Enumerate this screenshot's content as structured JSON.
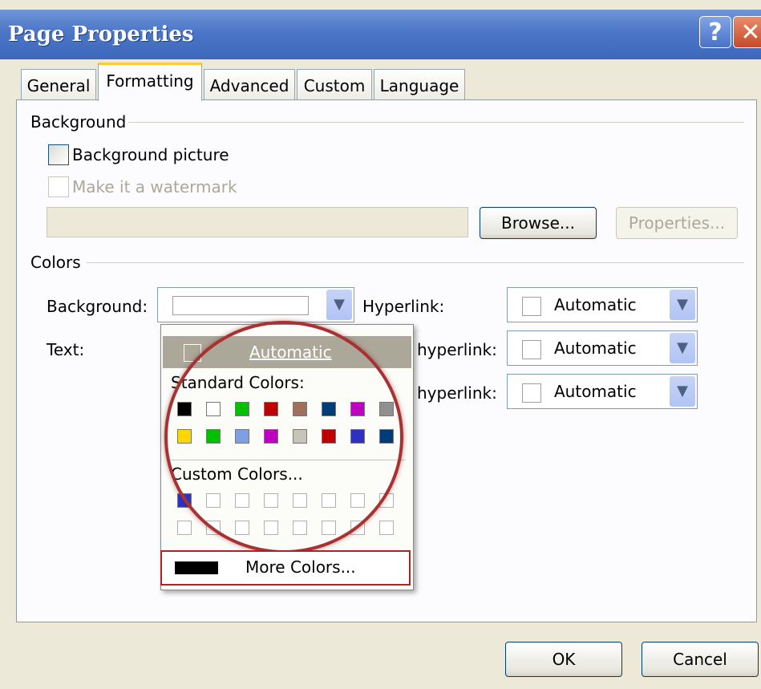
{
  "window": {
    "title": "Page Properties",
    "help_glyph": "?",
    "close_glyph": "✕"
  },
  "tabs": [
    {
      "label": "General"
    },
    {
      "label": "Formatting",
      "active": true
    },
    {
      "label": "Advanced"
    },
    {
      "label": "Custom"
    },
    {
      "label": "Language"
    }
  ],
  "background_group": {
    "label": "Background",
    "background_picture_label": "Background picture",
    "watermark_label": "Make it a watermark",
    "picture_path_value": "",
    "browse_label": "Browse...",
    "properties_label": "Properties..."
  },
  "colors_group": {
    "label": "Colors",
    "background_label": "Background:",
    "text_label": "Text:",
    "hyperlink_label": "Hyperlink:",
    "visited_label": "hyperlink:",
    "active_label": "hyperlink:",
    "automatic": "Automatic",
    "arrow_glyph": "▼"
  },
  "color_picker": {
    "automatic_label": "Automatic",
    "standard_label": "Standard Colors:",
    "custom_label": "Custom Colors...",
    "more_label": "More Colors...",
    "standard_colors": [
      "#000000",
      "#ffffff",
      "#00c000",
      "#c00000",
      "#a0705a",
      "#003c78",
      "#c000c0",
      "#909090",
      "#ffd700",
      "#00c000",
      "#7fa0e0",
      "#c000c0",
      "#c8c4b8",
      "#c00000",
      "#3030c0",
      "#003c78"
    ],
    "custom_colors": [
      "#2b34c8",
      "",
      "",
      "",
      "",
      "",
      "",
      "",
      "",
      "",
      "",
      "",
      "",
      "",
      "",
      ""
    ],
    "more_swatch_color": "#000000"
  },
  "footer": {
    "ok_label": "OK",
    "cancel_label": "Cancel"
  },
  "accent_colors": {
    "highlight": "#b22222",
    "titlebar": "#4c76c7"
  }
}
